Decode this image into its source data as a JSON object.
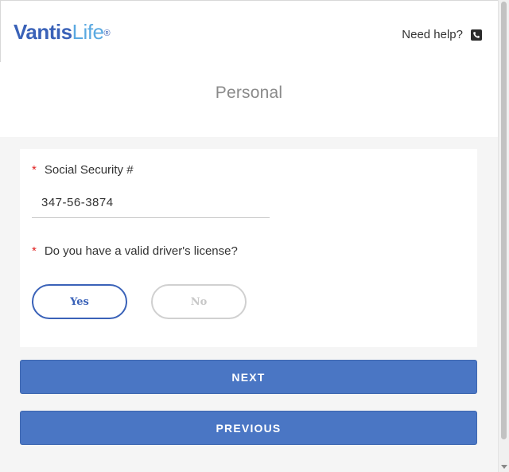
{
  "header": {
    "logo_brand": "Vantis",
    "logo_product": "Life",
    "logo_reg": "®",
    "help_label": "Need help?",
    "help_icon": "phone-icon"
  },
  "page": {
    "title": "Personal"
  },
  "form": {
    "required_mark": "*",
    "ssn_label": "Social Security #",
    "ssn_value": "347-56-3874",
    "license_question": "Do you have a valid driver's license?",
    "options": [
      {
        "label": "Yes",
        "selected": true
      },
      {
        "label": "No",
        "selected": false
      }
    ]
  },
  "actions": {
    "next_label": "NEXT",
    "previous_label": "PREVIOUS"
  },
  "colors": {
    "brand_blue": "#3a62b8",
    "brand_light_blue": "#5aa9e1",
    "button_blue": "#4a76c4",
    "required_red": "#e02020"
  }
}
